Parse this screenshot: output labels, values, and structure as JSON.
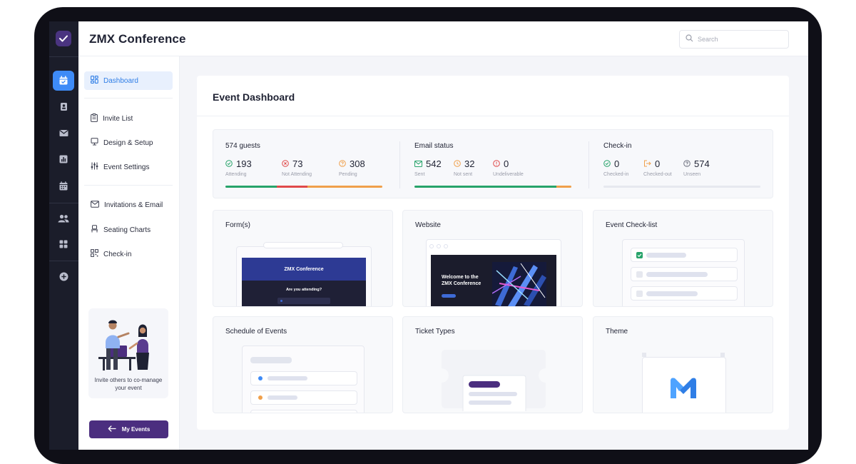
{
  "app": {
    "title": "ZMX Conference"
  },
  "search": {
    "placeholder": "Search"
  },
  "sidebar": {
    "items": [
      {
        "label": "Dashboard"
      },
      {
        "label": "Invite List"
      },
      {
        "label": "Design & Setup"
      },
      {
        "label": "Event Settings"
      },
      {
        "label": "Invitations & Email"
      },
      {
        "label": "Seating Charts"
      },
      {
        "label": "Check-in"
      }
    ],
    "invite_card_text": "Invite others to co-manage your event",
    "my_events_label": "My Events"
  },
  "dashboard": {
    "title": "Event Dashboard",
    "guests": {
      "heading": "574 guests",
      "stats": [
        {
          "value": "193",
          "label": "Attending",
          "color": "#27a36a"
        },
        {
          "value": "73",
          "label": "Not Attending",
          "color": "#e04a4a"
        },
        {
          "value": "308",
          "label": "Pending",
          "color": "#f0a04b"
        }
      ]
    },
    "email": {
      "heading": "Email status",
      "stats": [
        {
          "value": "542",
          "label": "Sent",
          "color": "#27a36a"
        },
        {
          "value": "32",
          "label": "Not sent",
          "color": "#f0a04b"
        },
        {
          "value": "0",
          "label": "Undeliverable",
          "color": "#e04a4a"
        }
      ]
    },
    "checkin": {
      "heading": "Check-in",
      "stats": [
        {
          "value": "0",
          "label": "Checked-in",
          "color": "#27a36a"
        },
        {
          "value": "0",
          "label": "Checked-out",
          "color": "#f0a04b"
        },
        {
          "value": "574",
          "label": "Unseen",
          "color": "#8a8d99"
        }
      ]
    },
    "cards": [
      {
        "title": "Form(s)"
      },
      {
        "title": "Website"
      },
      {
        "title": "Event Check-list"
      },
      {
        "title": "Schedule of Events"
      },
      {
        "title": "Ticket Types"
      },
      {
        "title": "Theme"
      }
    ],
    "form_preview": {
      "header": "ZMX Conference",
      "question": "Are you attending?"
    },
    "website_preview": {
      "headline": "Welcome to the ZMX Conference"
    }
  },
  "colors": {
    "accent": "#3e8bf7",
    "brand_purple": "#4b2e7f",
    "rail_bg": "#1b1d2a"
  }
}
